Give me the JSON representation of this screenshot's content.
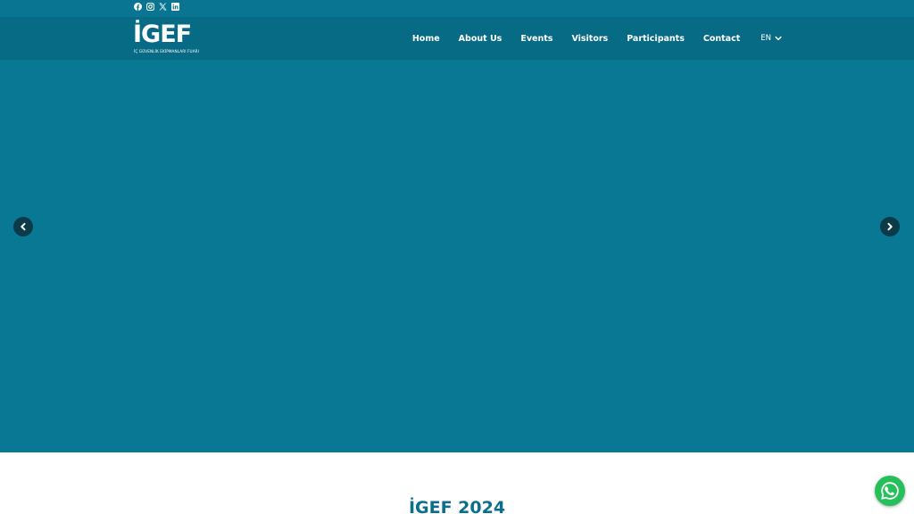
{
  "social": {
    "icons": [
      "facebook-icon",
      "instagram-icon",
      "x-icon",
      "linkedin-icon"
    ]
  },
  "logo": {
    "main": "İGEF",
    "subtitle": "İÇ GÜVENLİK EKİPMANLARI FUARI"
  },
  "nav": {
    "items": [
      "Home",
      "About Us",
      "Events",
      "Visitors",
      "Participants",
      "Contact"
    ],
    "language": "EN"
  },
  "hero": {
    "color": "#097894"
  },
  "section": {
    "title": "İGEF 2024"
  },
  "colors": {
    "topbar": "#0a7593",
    "navbar": "#086b86",
    "accent": "#0b6f8c",
    "whatsapp": "#25c05a"
  }
}
